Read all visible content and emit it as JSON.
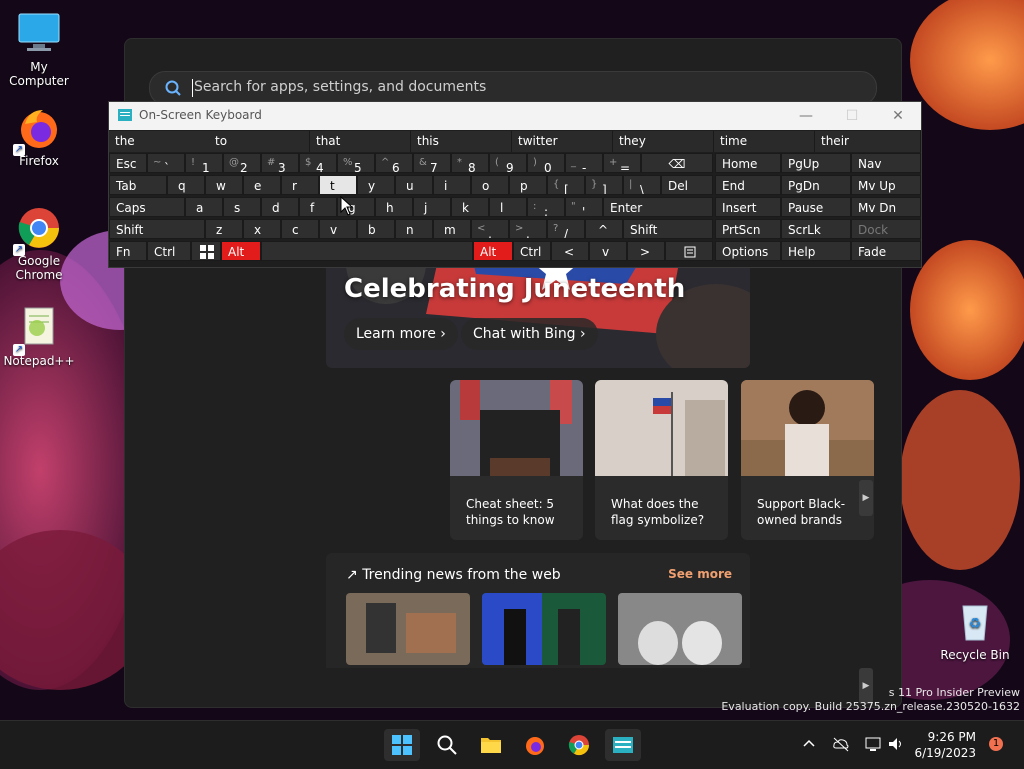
{
  "desktop": {
    "icons": [
      {
        "label": "My Computer"
      },
      {
        "label": "Firefox"
      },
      {
        "label": "Google Chrome"
      },
      {
        "label": "Notepad++"
      },
      {
        "label": "Recycle Bin"
      }
    ]
  },
  "search": {
    "placeholder": "Search for apps, settings, and documents"
  },
  "hero": {
    "title": "Celebrating Juneteenth",
    "buttons": [
      "Learn more",
      "Chat with Bing"
    ]
  },
  "cards": [
    {
      "line1": "Cheat sheet: 5",
      "line2": "things to know"
    },
    {
      "line1": "What does the",
      "line2": "flag symbolize?"
    },
    {
      "line1": "Support Black-",
      "line2": "owned brands"
    }
  ],
  "trending": {
    "title": "Trending news from the web",
    "see_more": "See more"
  },
  "osk": {
    "title": "On-Screen Keyboard",
    "predictions": [
      "the",
      "to",
      "that",
      "this",
      "twitter",
      "they",
      "time",
      "their"
    ],
    "row1": {
      "esc": "Esc",
      "keys": [
        {
          "s": "~",
          "m": "`"
        },
        {
          "s": "!",
          "m": "1"
        },
        {
          "s": "@",
          "m": "2"
        },
        {
          "s": "#",
          "m": "3"
        },
        {
          "s": "$",
          "m": "4"
        },
        {
          "s": "%",
          "m": "5"
        },
        {
          "s": "^",
          "m": "6"
        },
        {
          "s": "&",
          "m": "7"
        },
        {
          "s": "*",
          "m": "8"
        },
        {
          "s": "(",
          "m": "9"
        },
        {
          "s": ")",
          "m": "0"
        },
        {
          "s": "_",
          "m": "-"
        },
        {
          "s": "+",
          "m": "="
        }
      ],
      "backspace": "⌫"
    },
    "row2": {
      "tab": "Tab",
      "letters": [
        "q",
        "w",
        "e",
        "r",
        "t",
        "y",
        "u",
        "i",
        "o",
        "p"
      ],
      "brackets": [
        {
          "s": "{",
          "m": "["
        },
        {
          "s": "}",
          "m": "]"
        },
        {
          "s": "|",
          "m": "\\"
        }
      ],
      "del": "Del"
    },
    "row3": {
      "caps": "Caps",
      "letters": [
        "a",
        "s",
        "d",
        "f",
        "g",
        "h",
        "j",
        "k",
        "l"
      ],
      "punct": [
        {
          "s": ":",
          "m": ";"
        },
        {
          "s": "\"",
          "m": "'"
        }
      ],
      "enter": "Enter"
    },
    "row4": {
      "shift_left": "Shift",
      "letters": [
        "z",
        "x",
        "c",
        "v",
        "b",
        "n",
        "m"
      ],
      "punct": [
        {
          "s": "<",
          "m": ","
        },
        {
          "s": ">",
          "m": "."
        },
        {
          "s": "?",
          "m": "/"
        }
      ],
      "up": "^",
      "shift_right": "Shift"
    },
    "row5": {
      "fn": "Fn",
      "ctrl_left": "Ctrl",
      "alt_left": "Alt",
      "alt_right": "Alt",
      "ctrl_right": "Ctrl",
      "left": "<",
      "down": "v",
      "right": ">"
    },
    "nav": [
      [
        "Home",
        "PgUp",
        "Nav"
      ],
      [
        "End",
        "PgDn",
        "Mv Up"
      ],
      [
        "Insert",
        "Pause",
        "Mv Dn"
      ],
      [
        "PrtScn",
        "ScrLk",
        "Dock"
      ],
      [
        "Options",
        "Help",
        "Fade"
      ]
    ],
    "accent_red": "#e21b1b"
  },
  "watermark": {
    "line1": "s 11 Pro Insider Preview",
    "line2": "Evaluation copy. Build 25375.zn_release.230520-1632"
  },
  "taskbar": {
    "time": "9:26 PM",
    "date": "6/19/2023",
    "notifications": "1"
  }
}
